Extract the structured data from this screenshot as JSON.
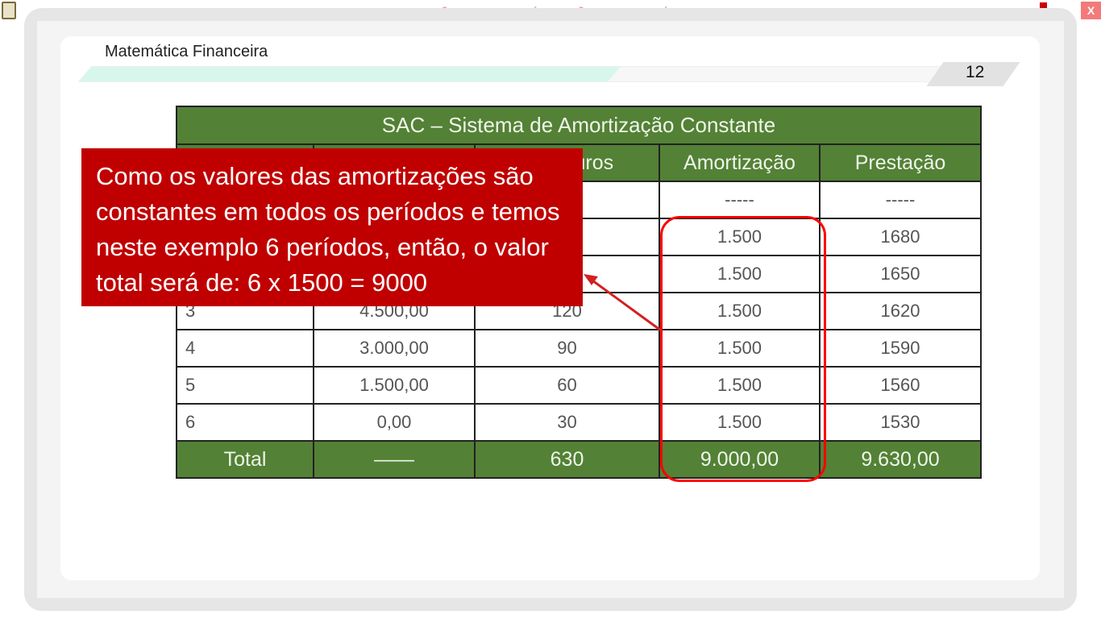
{
  "window": {
    "banner": "VERSÃO PARA FUNCIONÁRIOS - NÃO COMERCIALIZÁVEL",
    "close_label": "X"
  },
  "slide": {
    "subject": "Matemática Financeira",
    "page_number": "12"
  },
  "table": {
    "title": "SAC – Sistema de Amortização Constante",
    "headers": [
      "",
      "",
      "Juros",
      "Amortização",
      "Prestação"
    ],
    "rows": [
      [
        "",
        "",
        "",
        "-----",
        "-----"
      ],
      [
        "",
        "",
        "",
        "1.500",
        "1680"
      ],
      [
        "",
        "",
        "",
        "1.500",
        "1650"
      ],
      [
        "3",
        "4.500,00",
        "120",
        "1.500",
        "1620"
      ],
      [
        "4",
        "3.000,00",
        "90",
        "1.500",
        "1590"
      ],
      [
        "5",
        "1.500,00",
        "60",
        "1.500",
        "1560"
      ],
      [
        "6",
        "0,00",
        "30",
        "1.500",
        "1530"
      ]
    ],
    "total": [
      "Total",
      "——",
      "630",
      "9.000,00",
      "9.630,00"
    ]
  },
  "callout": {
    "text": "Como os valores das amortizações são constantes em todos os períodos e temos neste exemplo 6 períodos, então, o valor total será de: 6 x 1500 = 9000"
  },
  "colors": {
    "header_green": "#538135",
    "callout_red": "#c00000",
    "highlight": "#ff0000"
  }
}
